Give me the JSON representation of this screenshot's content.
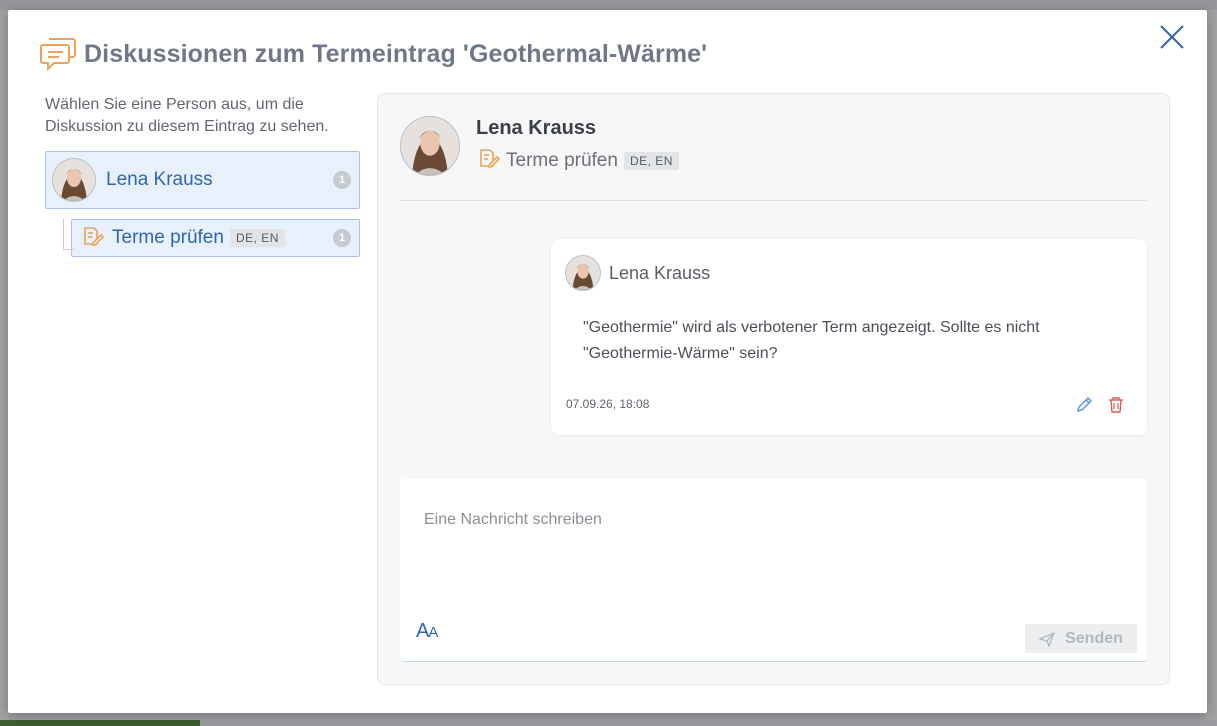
{
  "modal": {
    "title": "Diskussionen zum Termeintrag 'Geothermal-Wärme'"
  },
  "left_pane": {
    "hint": "Wählen Sie eine Person aus, um die Diskussion zu diesem Eintrag zu sehen.",
    "person": {
      "name": "Lena Krauss",
      "count": "1"
    },
    "task": {
      "name": "Terme prüfen",
      "langs": "DE, EN",
      "count": "1"
    }
  },
  "right_pane": {
    "header": {
      "name": "Lena Krauss",
      "task": "Terme prüfen",
      "langs": "DE, EN"
    },
    "message": {
      "author": "Lena Krauss",
      "text": "\"Geothermie\" wird als verbotener Term angezeigt. Sollte es nicht \"Geothermie-Wärme\" sein?",
      "timestamp": "07.09.26, 18:08"
    },
    "composer": {
      "placeholder": "Eine Nachricht schreiben",
      "format_label": "A",
      "format_label_small": "A",
      "send_label": "Senden"
    }
  },
  "colors": {
    "accent": "#2f66ad",
    "icon_orange": "#e8a35c",
    "delete_red": "#e05a5a"
  },
  "icons": [
    "discussion-icon",
    "close-icon",
    "task-edit-icon",
    "pencil-icon",
    "trash-icon",
    "send-icon",
    "avatar"
  ]
}
